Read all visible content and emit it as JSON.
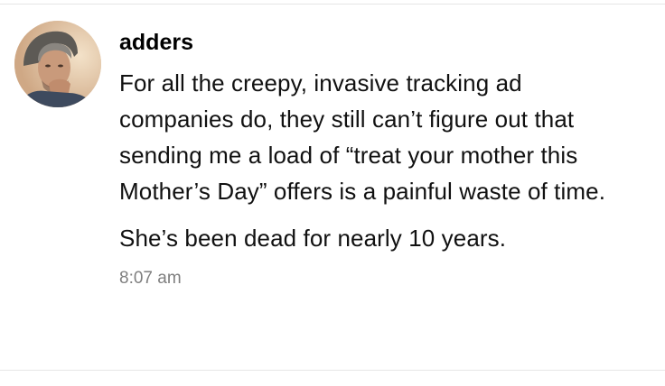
{
  "message": {
    "author": "adders",
    "avatar_icon": "user-avatar-photo",
    "paragraphs": [
      "For all the creepy, invasive tracking ad companies do, they still can’t figure out that sending me a load of “treat your mother this Mother’s Day” offers is a painful waste of time.",
      "She’s been dead for nearly 10 years."
    ],
    "timestamp": "8:07 am"
  },
  "colors": {
    "background": "#ffffff",
    "text": "#111111",
    "author": "#000000",
    "timestamp": "#7f7f7f",
    "divider": "#e6e6e6"
  }
}
